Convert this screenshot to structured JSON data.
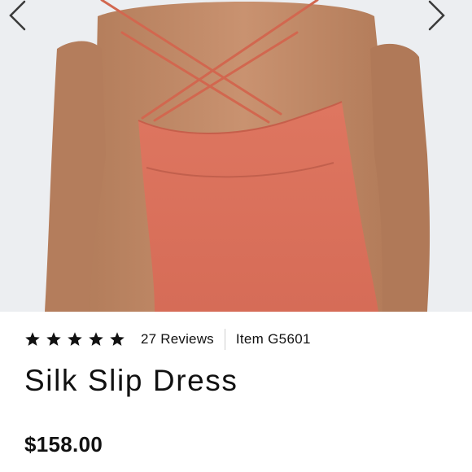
{
  "gallery": {
    "image_alt": "Back view of coral silk slip dress with crisscross straps",
    "dress_color": "#d9705c",
    "prev_icon": "chevron-left-icon",
    "next_icon": "chevron-right-icon"
  },
  "product": {
    "rating": 5,
    "rating_max": 5,
    "reviews_label": "27 Reviews",
    "item_code": "Item G5601",
    "title": "Silk Slip Dress",
    "price": "$158.00"
  }
}
